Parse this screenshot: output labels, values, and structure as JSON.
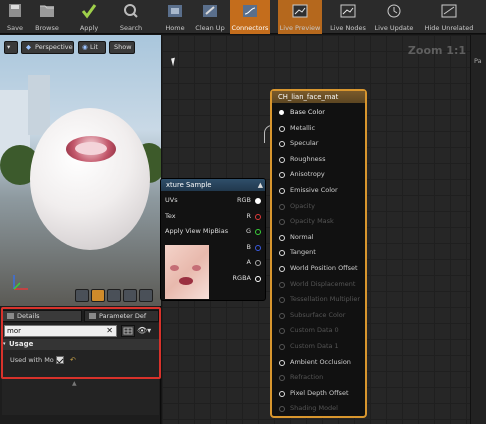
{
  "toolbar": {
    "items": [
      {
        "label": "Save",
        "icon": "save-icon"
      },
      {
        "label": "Browse",
        "icon": "browse-icon"
      },
      {
        "label": "Apply",
        "icon": "apply-icon"
      },
      {
        "label": "Search",
        "icon": "search-icon"
      },
      {
        "label": "Home",
        "icon": "home-icon"
      },
      {
        "label": "Clean Up",
        "icon": "cleanup-icon"
      },
      {
        "label": "Connectors",
        "icon": "connectors-icon"
      },
      {
        "label": "Live Preview",
        "icon": "live-preview-icon"
      },
      {
        "label": "Live Nodes",
        "icon": "live-nodes-icon"
      },
      {
        "label": "Live Update",
        "icon": "live-update-icon"
      },
      {
        "label": "Hide Unrelated",
        "icon": "hide-unrelated-icon"
      }
    ]
  },
  "viewport": {
    "perspective_label": "Perspective",
    "lit_label": "Lit",
    "show_label": "Show"
  },
  "details": {
    "tab_details": "Details",
    "tab_param": "Parameter Def",
    "search_value": "mor",
    "usage_header": "Usage",
    "used_with_label": "Used with Mo"
  },
  "graph": {
    "zoom_label": "Zoom 1:1",
    "right_tab_label": "Pa"
  },
  "material_node": {
    "title": "CH_lian_face_mat",
    "pins": [
      {
        "label": "Base Color",
        "state": "on"
      },
      {
        "label": "Metallic",
        "state": "hollow"
      },
      {
        "label": "Specular",
        "state": "hollow"
      },
      {
        "label": "Roughness",
        "state": "hollow"
      },
      {
        "label": "Anisotropy",
        "state": "hollow"
      },
      {
        "label": "Emissive Color",
        "state": "hollow"
      },
      {
        "label": "Opacity",
        "state": "off"
      },
      {
        "label": "Opacity Mask",
        "state": "off"
      },
      {
        "label": "Normal",
        "state": "hollow"
      },
      {
        "label": "Tangent",
        "state": "hollow"
      },
      {
        "label": "World Position Offset",
        "state": "hollow"
      },
      {
        "label": "World Displacement",
        "state": "off"
      },
      {
        "label": "Tessellation Multiplier",
        "state": "off"
      },
      {
        "label": "Subsurface Color",
        "state": "off"
      },
      {
        "label": "Custom Data 0",
        "state": "off"
      },
      {
        "label": "Custom Data 1",
        "state": "off"
      },
      {
        "label": "Ambient Occlusion",
        "state": "hollow"
      },
      {
        "label": "Refraction",
        "state": "off"
      },
      {
        "label": "Pixel Depth Offset",
        "state": "hollow"
      },
      {
        "label": "Shading Model",
        "state": "off"
      }
    ]
  },
  "texture_node": {
    "title": "xture Sample",
    "inputs": [
      "UVs",
      "Tex",
      "Apply View MipBias"
    ],
    "outputs": [
      {
        "label": "RGB",
        "color": "#ffffff"
      },
      {
        "label": "R",
        "color": "#e03a3a"
      },
      {
        "label": "G",
        "color": "#3ad03a"
      },
      {
        "label": "B",
        "color": "#3a5ae0"
      },
      {
        "label": "A",
        "color": "#aaaaaa"
      },
      {
        "label": "RGBA",
        "color": "#ffffff"
      }
    ]
  },
  "colors": {
    "accent_orange": "#d8962e",
    "highlight_red": "#d8322b",
    "toolbar_active": "#c46d1c"
  }
}
